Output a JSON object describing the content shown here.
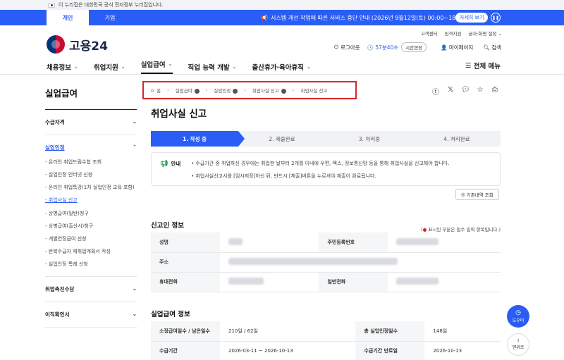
{
  "gov_banner": {
    "text": "이 누리집은 대한민국 공식 전자정부 누리집입니다."
  },
  "notice_bar": {
    "tabs": [
      "개인",
      "기업"
    ],
    "notice": "시스템 개선 작업에 따른 서비스 중단 안내 (2026년 9월12일(토) 00:00~18:00)",
    "detail_button": "자세히 보기"
  },
  "util_links": [
    "고객센터",
    "원격지원",
    "글자·화면 설정"
  ],
  "logo": {
    "text": "고용24"
  },
  "user_area": {
    "logout": "로그아웃",
    "timer": "57분40초",
    "extend": "시간연장",
    "mypage": "마이페이지",
    "search": "검색"
  },
  "gnb": {
    "items": [
      "채용정보",
      "취업지원",
      "실업급여",
      "직업 능력 개발",
      "출산휴가·육아휴직"
    ],
    "all_menu": "전체 메뉴"
  },
  "lnb": {
    "title": "실업급여",
    "groups": [
      "수급자격",
      "실업인정",
      "취업촉진수당",
      "이직확인서"
    ],
    "sub_items": [
      "- 온라인 취업드림수첩 조회",
      "- 실업인정 인터넷 신청",
      "- 온라인 취업특강(1차 실업인정 교육 포함)",
      "- 취업사실 신고",
      "- 상병급여(일반)청구",
      "- 상병급여(출산시)청구",
      "- 개별연장급여 신청",
      "- 반복수급자 재취업계획서 작성",
      "- 실업인정 특례 신청"
    ]
  },
  "breadcrumb": [
    "홈",
    "실업급여",
    "실업인정",
    "취업사실 신고",
    "취업사실 신고"
  ],
  "page_title": "취업사실 신고",
  "steps": [
    "1. 작성 중",
    "2. 제출완료",
    "3. 처리중",
    "4. 처리완료"
  ],
  "info": {
    "label": "안내",
    "lines": [
      "수급기간 중 취업하신 경우에는 취업한 날부터 2개월 이내에 우편, 팩스, 정보통신망 등을 통해 취업사실을 신고해야 합니다.",
      "취업사실신고서를 [임시저장]하신 뒤, 반드시 [제출]버튼을 누르셔야 제출이 완료됩니다."
    ]
  },
  "history_button": "기존내역 조회",
  "reporter_section": {
    "title": "신고인 정보",
    "required_note": "표시된 부분은 필수 입력 항목입니다.",
    "labels": {
      "name": "성명",
      "rrn": "주민등록번호",
      "address": "주소",
      "mobile": "휴대전화",
      "phone": "일반전화"
    }
  },
  "benefit_section": {
    "title": "실업급여 정보",
    "labels": {
      "days": "소정급여일수 / 남은일수",
      "total": "총 실업인정일수",
      "period": "수급기간",
      "expiry": "수급기간 만료일"
    },
    "values": {
      "days": "210일 / 62일",
      "total": "148일",
      "period": "2026-03-11 ~ 2026-10-13",
      "expiry": "2026-10-13"
    }
  },
  "floating": {
    "help": "도우미",
    "top": "맨위로"
  }
}
